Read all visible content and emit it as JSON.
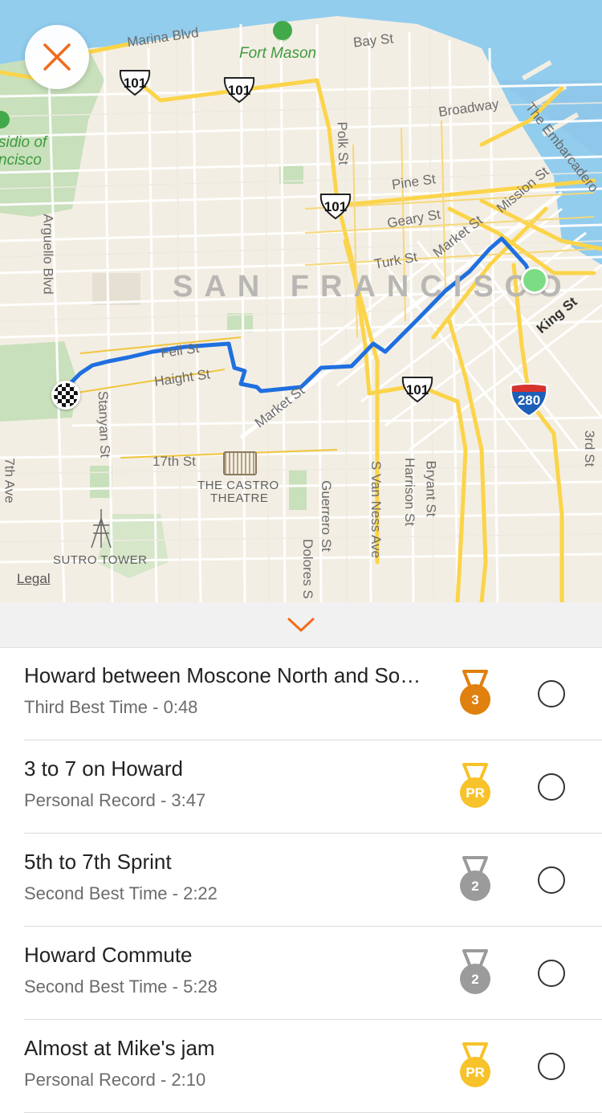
{
  "colors": {
    "accent": "#f26b1d",
    "route": "#1f6fe0",
    "bronze": "#e0800e",
    "gold": "#f7c22a",
    "silver": "#9b9b9b",
    "start_dot": "#7cdc83"
  },
  "map": {
    "city_label": "SAN FRANCISCO",
    "park_labels": {
      "fort_mason": "Fort Mason",
      "presidio_line1": "sidio of",
      "presidio_line2": "ncisco"
    },
    "streets": {
      "marina": "Marina Blvd",
      "bay": "Bay St",
      "broadway": "Broadway",
      "embarcadero": "The Embarcadero",
      "polk": "Polk St",
      "pine": "Pine St",
      "mission": "Mission St",
      "geary": "Geary St",
      "market_ne": "Market St",
      "turk": "Turk St",
      "arguello": "Arguello Blvd",
      "king": "King St",
      "fell": "Fell St",
      "haight": "Haight St",
      "market_sw": "Market St",
      "stanyan": "Stanyan St",
      "seventeenth": "17th St",
      "seventh_ave": "7th Ave",
      "guerrero": "Guerrero St",
      "dolores": "Dolores S",
      "van_ness": "S Van Ness Ave",
      "harrison": "Harrison St",
      "bryant": "Bryant St",
      "third": "3rd St"
    },
    "poi": {
      "castro_line1": "THE CASTRO",
      "castro_line2": "THEATRE",
      "sutro": "SUTRO TOWER"
    },
    "shields": {
      "us101_a": "101",
      "us101_b": "101",
      "us101_c": "101",
      "us101_d": "101",
      "i280": "280"
    },
    "legal": "Legal"
  },
  "icons": {
    "close": "close-icon",
    "collapse": "chevron-down-icon",
    "finish": "checkered-flag-icon",
    "start": "start-dot-icon"
  },
  "segments": [
    {
      "title": "Howard between Moscone North and South",
      "subtitle": "Third Best Time - 0:48",
      "medal": "3",
      "medal_type": "bronze"
    },
    {
      "title": "3 to 7 on Howard",
      "subtitle": "Personal Record - 3:47",
      "medal": "PR",
      "medal_type": "gold"
    },
    {
      "title": "5th to 7th Sprint",
      "subtitle": "Second Best Time - 2:22",
      "medal": "2",
      "medal_type": "silver"
    },
    {
      "title": "Howard Commute",
      "subtitle": "Second Best Time - 5:28",
      "medal": "2",
      "medal_type": "silver"
    },
    {
      "title": "Almost at Mike's jam",
      "subtitle": "Personal Record - 2:10",
      "medal": "PR",
      "medal_type": "gold"
    }
  ]
}
